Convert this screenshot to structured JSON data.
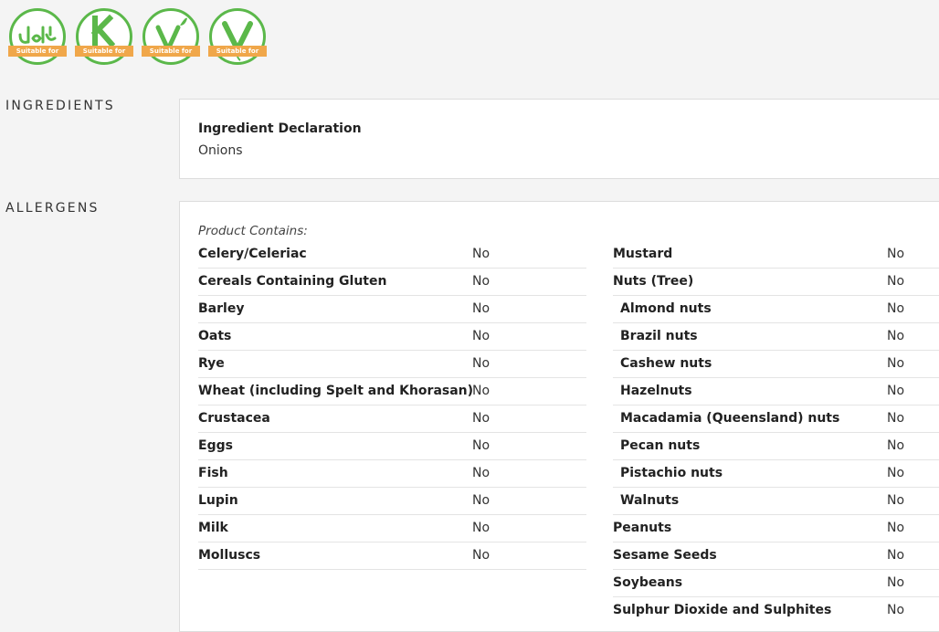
{
  "badges": [
    {
      "icon": "halal-icon",
      "label": "Suitable for"
    },
    {
      "icon": "kosher-icon",
      "label": "Suitable for"
    },
    {
      "icon": "vegetarian-icon",
      "label": "Suitable for"
    },
    {
      "icon": "vegan-icon",
      "label": "Suitable for"
    }
  ],
  "colors": {
    "badge_green": "#5bb84a",
    "badge_orange": "#f0a74a"
  },
  "ingredients": {
    "section_label": "INGREDIENTS",
    "title": "Ingredient Declaration",
    "value": "Onions"
  },
  "allergens": {
    "section_label": "ALLERGENS",
    "contains_label": "Product Contains:",
    "left": [
      {
        "name": "Celery/Celeriac",
        "value": "No"
      },
      {
        "name": "Cereals Containing Gluten",
        "value": "No"
      },
      {
        "name": "Barley",
        "value": "No"
      },
      {
        "name": "Oats",
        "value": "No"
      },
      {
        "name": "Rye",
        "value": "No"
      },
      {
        "name": "Wheat (including Spelt and Khorasan)",
        "value": "No"
      },
      {
        "name": "Crustacea",
        "value": "No"
      },
      {
        "name": "Eggs",
        "value": "No"
      },
      {
        "name": "Fish",
        "value": "No"
      },
      {
        "name": "Lupin",
        "value": "No"
      },
      {
        "name": "Milk",
        "value": "No"
      },
      {
        "name": "Molluscs",
        "value": "No"
      }
    ],
    "right": [
      {
        "name": "Mustard",
        "value": "No"
      },
      {
        "name": "Nuts (Tree)",
        "value": "No"
      },
      {
        "name": "Almond nuts",
        "value": "No"
      },
      {
        "name": "Brazil nuts",
        "value": "No"
      },
      {
        "name": "Cashew nuts",
        "value": "No"
      },
      {
        "name": "Hazelnuts",
        "value": "No"
      },
      {
        "name": "Macadamia (Queensland) nuts",
        "value": "No"
      },
      {
        "name": "Pecan nuts",
        "value": "No"
      },
      {
        "name": "Pistachio nuts",
        "value": "No"
      },
      {
        "name": "Walnuts",
        "value": "No"
      },
      {
        "name": "Peanuts",
        "value": "No"
      },
      {
        "name": "Sesame Seeds",
        "value": "No"
      },
      {
        "name": "Soybeans",
        "value": "No"
      },
      {
        "name": "Sulphur Dioxide and Sulphites",
        "value": "No"
      }
    ]
  }
}
